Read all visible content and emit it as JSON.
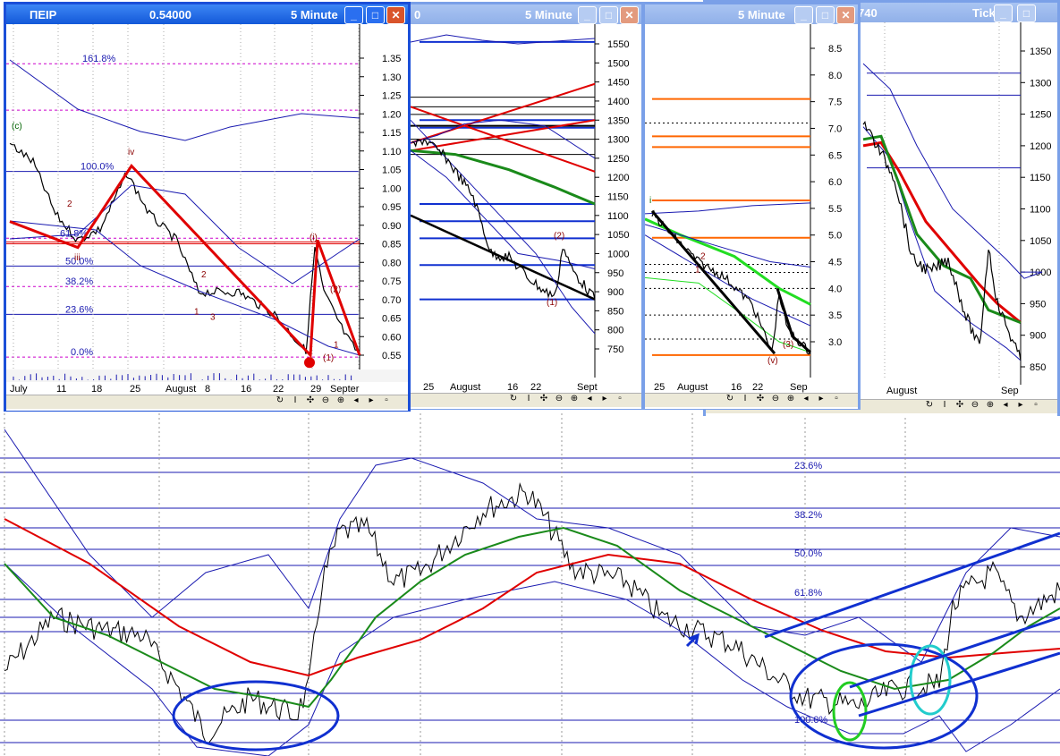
{
  "windows": {
    "w1": {
      "symbol": "ΠΕΙΡ",
      "price": "0.54000",
      "interval": "5 Minute"
    },
    "w2": {
      "symbol": "0",
      "interval": "5 Minute"
    },
    "w3": {
      "interval": "5 Minute"
    },
    "w4": {
      "symbol": "740",
      "interval": "Tick"
    }
  },
  "buttons": {
    "minimize": "_",
    "maximize": "□",
    "close": "✕"
  },
  "toolbar_icons": [
    "↻",
    "I",
    "✣",
    "⊖",
    "⊕",
    "◂",
    "▸",
    "▫"
  ],
  "colors": {
    "title_active": "#0f55d6",
    "title_inactive": "#8eaee8",
    "red_ma": "#e00000",
    "green_ma": "#1a8a1a",
    "bands": "#1a1ab0"
  },
  "chart_data": [
    {
      "type": "line",
      "title": "ΠΕΙΡ 5 Minute",
      "y_ticks": [
        "1.35",
        "1.30",
        "1.25",
        "1.20",
        "1.15",
        "1.10",
        "1.05",
        "1.00",
        "0.95",
        "0.90",
        "0.85",
        "0.80",
        "0.75",
        "0.70",
        "0.65",
        "0.60",
        "0.55"
      ],
      "x_ticks": [
        "July",
        "11",
        "18",
        "25",
        "August",
        "8",
        "16",
        "22",
        "29",
        "Septer"
      ],
      "fib_levels": [
        "161.8%",
        "100.0%",
        "61.8%",
        "50.0%",
        "38.2%",
        "23.6%",
        "0.0%"
      ],
      "wave_labels": [
        "(c)",
        "iv",
        "iii",
        "2",
        "2",
        "1",
        "3",
        "(i)",
        "(2)",
        "(1)",
        "1"
      ],
      "ylim": [
        0.52,
        1.38
      ]
    },
    {
      "type": "line",
      "title": "5 Minute",
      "y_ticks": [
        "1550",
        "1500",
        "1450",
        "1400",
        "1350",
        "1300",
        "1250",
        "1200",
        "1150",
        "1100",
        "1050",
        "1000",
        "950",
        "900",
        "850",
        "800",
        "750"
      ],
      "x_ticks": [
        "25",
        "August",
        "16",
        "22",
        "Sept"
      ],
      "wave_labels": [
        "(2)",
        "(1)"
      ],
      "ylim": [
        740,
        1570
      ]
    },
    {
      "type": "line",
      "title": "5 Minute",
      "y_ticks": [
        "8.5",
        "8.0",
        "7.5",
        "7.0",
        "6.5",
        "6.0",
        "5.5",
        "5.0",
        "4.5",
        "4.0",
        "3.5",
        "3.0"
      ],
      "x_ticks": [
        "25",
        "August",
        "16",
        "22",
        "Sep"
      ],
      "wave_labels": [
        "i",
        "2",
        "1",
        "(3)",
        "(v)"
      ],
      "ylim": [
        2.6,
        8.7
      ]
    },
    {
      "type": "line",
      "title": "Tick",
      "y_ticks": [
        "1350",
        "1300",
        "1250",
        "1200",
        "1150",
        "1100",
        "1050",
        "1000",
        "950",
        "900",
        "850"
      ],
      "x_ticks": [
        "August",
        "Sep"
      ],
      "ylim": [
        840,
        1370
      ]
    },
    {
      "type": "line",
      "title": "",
      "fib_levels": [
        "23.6%",
        "38.2%",
        "50.0%",
        "61.8%",
        "100.0%"
      ]
    }
  ]
}
